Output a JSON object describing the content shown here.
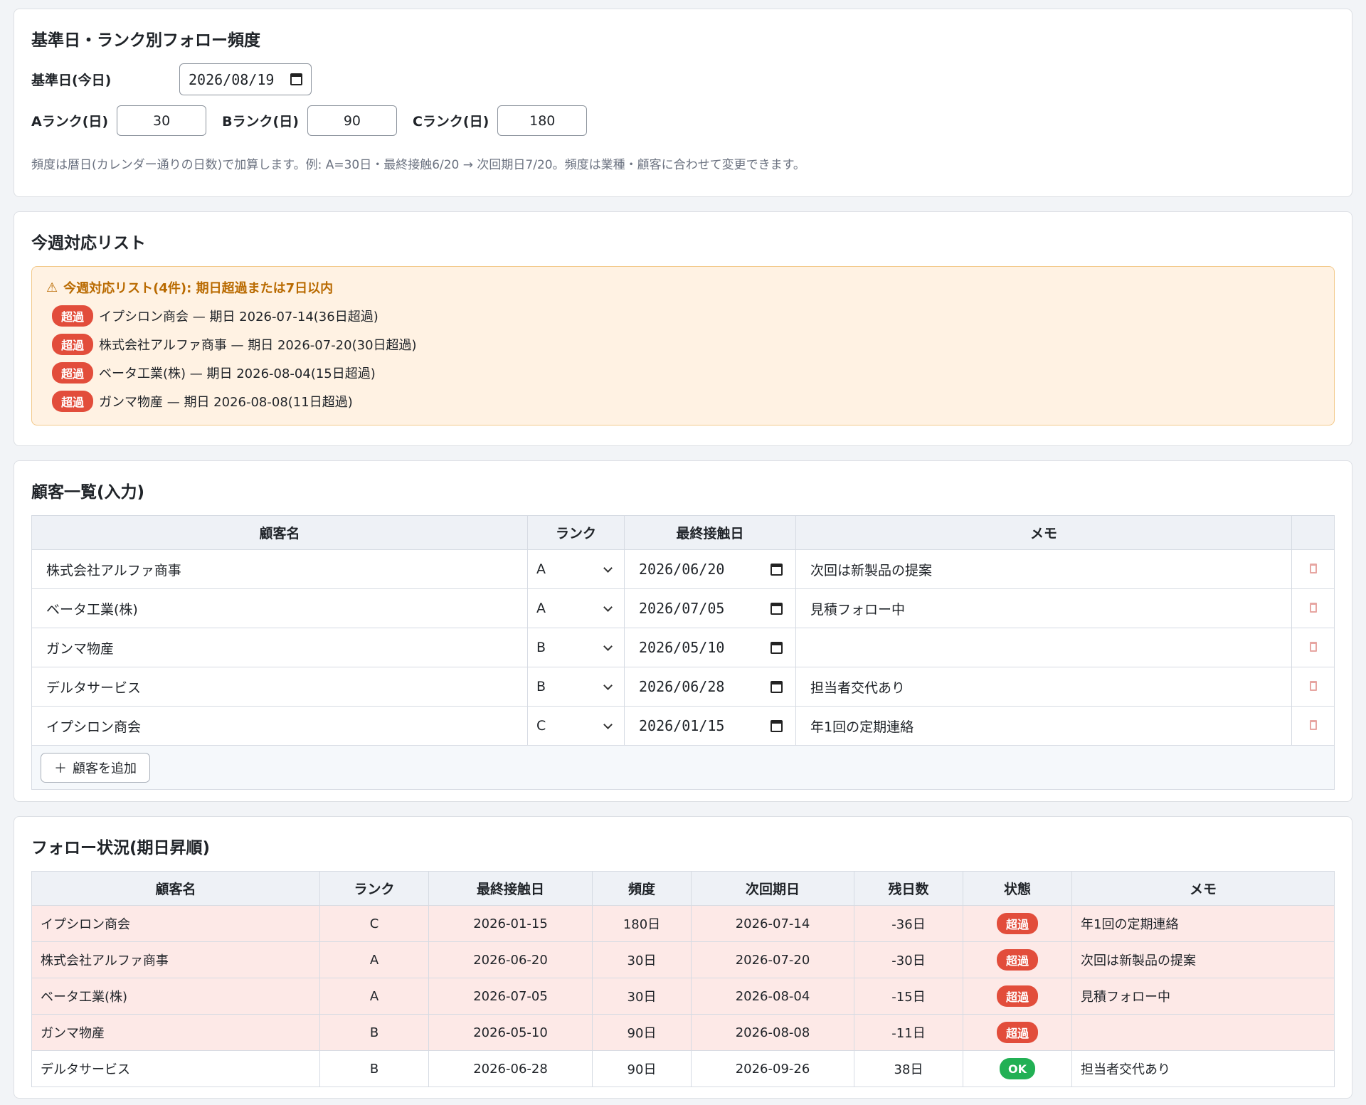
{
  "settings": {
    "title": "基準日・ランク別フォロー頻度",
    "base_date_label": "基準日(今日)",
    "base_date_value": "2026/08/19",
    "a_label": "Aランク(日)",
    "a_value": "30",
    "b_label": "Bランク(日)",
    "b_value": "90",
    "c_label": "Cランク(日)",
    "c_value": "180",
    "hint": "頻度は暦日(カレンダー通りの日数)で加算します。例: A=30日・最終接触6/20 → 次回期日7/20。頻度は業種・顧客に合わせて変更できます。"
  },
  "weekly": {
    "title": "今週対応リスト",
    "alert_title": "今週対応リスト(4件): 期日超過または7日以内",
    "items": [
      {
        "badge": "超過",
        "text": "イプシロン商会 — 期日 2026-07-14(36日超過)"
      },
      {
        "badge": "超過",
        "text": "株式会社アルファ商事 — 期日 2026-07-20(30日超過)"
      },
      {
        "badge": "超過",
        "text": "ベータ工業(株) — 期日 2026-08-04(15日超過)"
      },
      {
        "badge": "超過",
        "text": "ガンマ物産 — 期日 2026-08-08(11日超過)"
      }
    ]
  },
  "customers": {
    "title": "顧客一覧(入力)",
    "headers": [
      "顧客名",
      "ランク",
      "最終接触日",
      "メモ",
      ""
    ],
    "rows": [
      {
        "name": "株式会社アルファ商事",
        "rank": "A",
        "date": "2026/06/20",
        "memo": "次回は新製品の提案"
      },
      {
        "name": "ベータ工業(株)",
        "rank": "A",
        "date": "2026/07/05",
        "memo": "見積フォロー中"
      },
      {
        "name": "ガンマ物産",
        "rank": "B",
        "date": "2026/05/10",
        "memo": ""
      },
      {
        "name": "デルタサービス",
        "rank": "B",
        "date": "2026/06/28",
        "memo": "担当者交代あり"
      },
      {
        "name": "イプシロン商会",
        "rank": "C",
        "date": "2026/01/15",
        "memo": "年1回の定期連絡"
      }
    ],
    "add_button": "顧客を追加"
  },
  "status": {
    "title": "フォロー状況(期日昇順)",
    "headers": [
      "顧客名",
      "ランク",
      "最終接触日",
      "頻度",
      "次回期日",
      "残日数",
      "状態",
      "メモ"
    ],
    "rows": [
      {
        "name": "イプシロン商会",
        "rank": "C",
        "last": "2026-01-15",
        "freq": "180日",
        "next": "2026-07-14",
        "remain": "-36日",
        "state": "超過",
        "memo": "年1回の定期連絡",
        "overdue": true
      },
      {
        "name": "株式会社アルファ商事",
        "rank": "A",
        "last": "2026-06-20",
        "freq": "30日",
        "next": "2026-07-20",
        "remain": "-30日",
        "state": "超過",
        "memo": "次回は新製品の提案",
        "overdue": true
      },
      {
        "name": "ベータ工業(株)",
        "rank": "A",
        "last": "2026-07-05",
        "freq": "30日",
        "next": "2026-08-04",
        "remain": "-15日",
        "state": "超過",
        "memo": "見積フォロー中",
        "overdue": true
      },
      {
        "name": "ガンマ物産",
        "rank": "B",
        "last": "2026-05-10",
        "freq": "90日",
        "next": "2026-08-08",
        "remain": "-11日",
        "state": "超過",
        "memo": "",
        "overdue": true
      },
      {
        "name": "デルタサービス",
        "rank": "B",
        "last": "2026-06-28",
        "freq": "90日",
        "next": "2026-09-26",
        "remain": "38日",
        "state": "OK",
        "memo": "担当者交代あり",
        "overdue": false
      }
    ]
  }
}
